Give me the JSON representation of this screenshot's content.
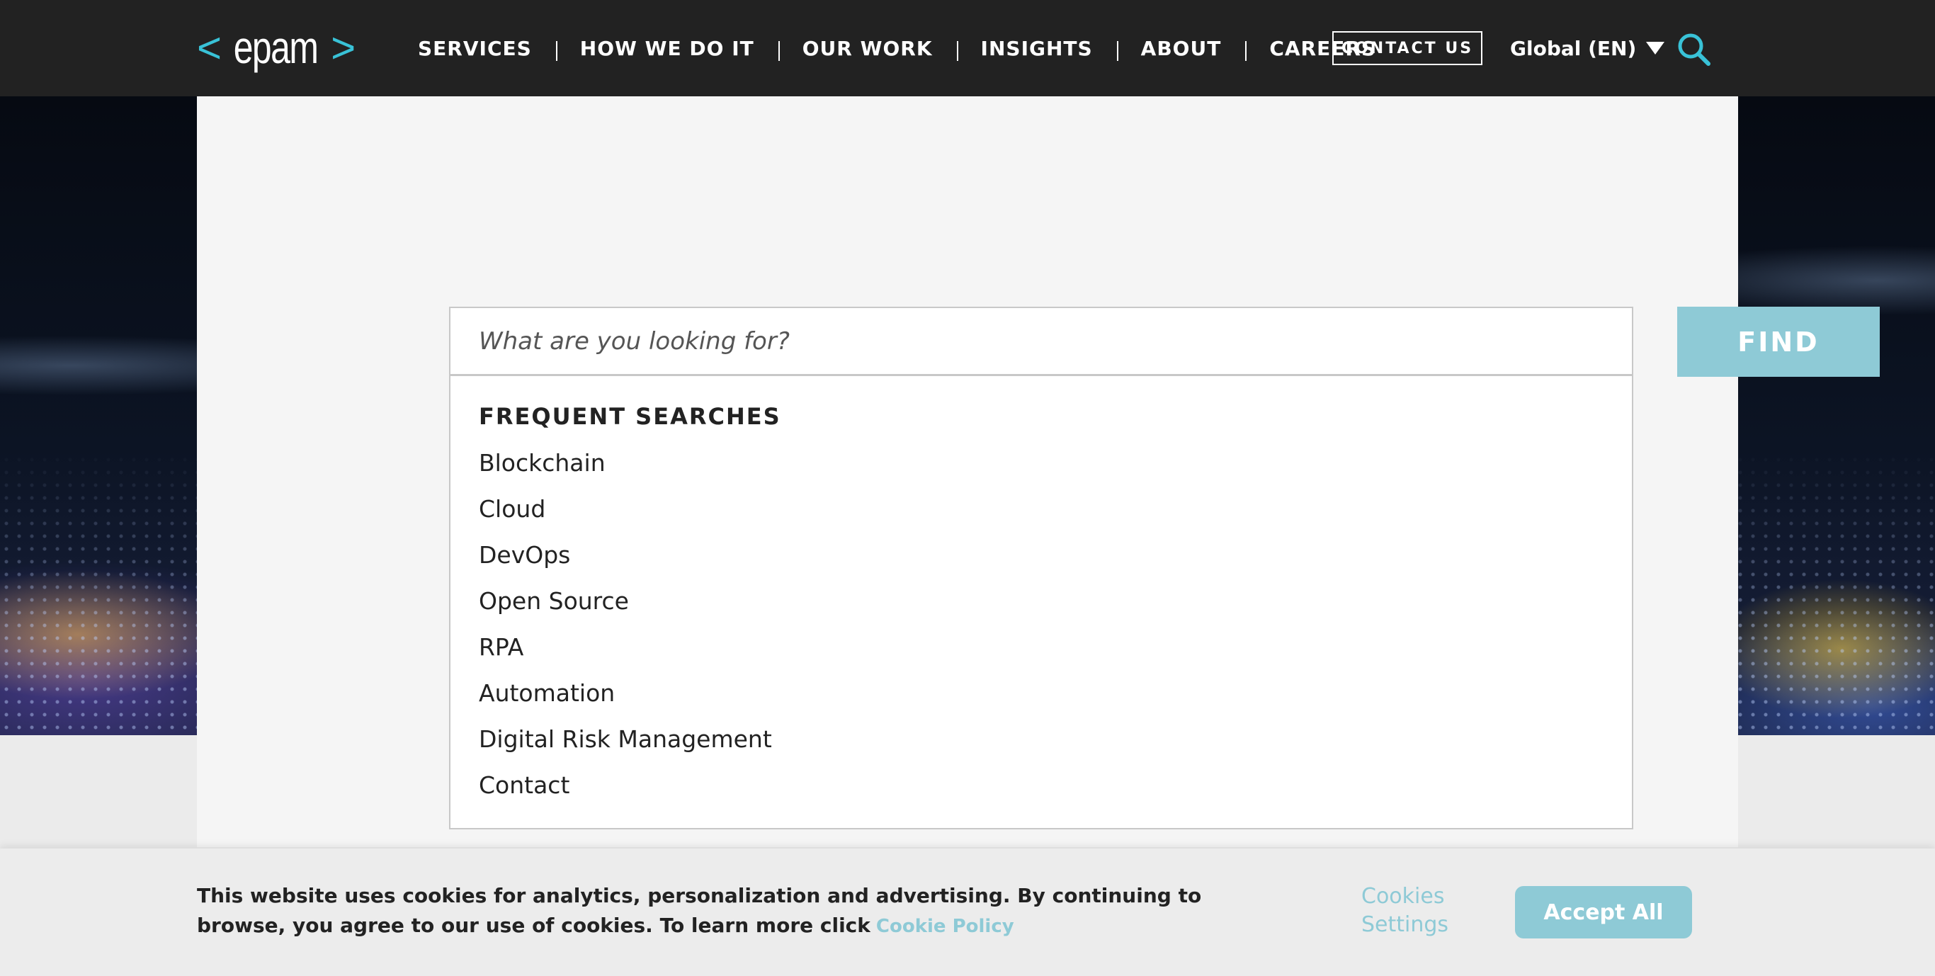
{
  "header": {
    "logo": {
      "bracket_left": "<",
      "word": "epam",
      "bracket_right": ">"
    },
    "nav": [
      {
        "label": "SERVICES"
      },
      {
        "label": "HOW WE DO IT"
      },
      {
        "label": "OUR WORK"
      },
      {
        "label": "INSIGHTS"
      },
      {
        "label": "ABOUT"
      },
      {
        "label": "CAREERS"
      }
    ],
    "contact_label": "CONTACT US",
    "language_label": "Global (EN)",
    "search_icon": "search-icon"
  },
  "search": {
    "placeholder": "What are you looking for?",
    "value": "",
    "find_label": "FIND",
    "frequent_heading": "FREQUENT SEARCHES",
    "frequent": [
      {
        "label": "Blockchain"
      },
      {
        "label": "Cloud"
      },
      {
        "label": "DevOps"
      },
      {
        "label": "Open Source"
      },
      {
        "label": "RPA"
      },
      {
        "label": "Automation"
      },
      {
        "label": "Digital Risk Management"
      },
      {
        "label": "Contact"
      }
    ]
  },
  "cookie_banner": {
    "text": "This website uses cookies for analytics, personalization and advertising. By continuing to browse, you agree to our use of cookies. To learn more click",
    "policy_link": "Cookie Policy",
    "settings_label": "Cookies Settings",
    "accept_label": "Accept All"
  },
  "colors": {
    "header_bg": "#222222",
    "accent": "#8ecad6",
    "logo_accent": "#39c2d7",
    "panel_bg": "#f5f5f5"
  }
}
